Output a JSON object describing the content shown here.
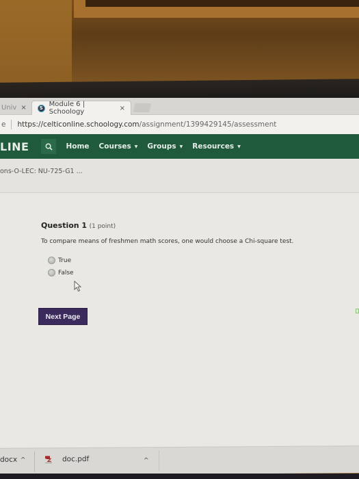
{
  "browser": {
    "tabs": [
      {
        "label": "Univ",
        "active": false,
        "close": "×"
      },
      {
        "label": "Module 6 | Schoology",
        "active": true,
        "favicon": "S",
        "close": "×"
      }
    ],
    "address": {
      "security_fragment": "e",
      "host": "https://celticonline.schoology.com",
      "path": "/assignment/1399429145/assessment"
    }
  },
  "navbar": {
    "logo": "LINE",
    "items": [
      {
        "label": "Home",
        "dropdown": false
      },
      {
        "label": "Courses",
        "dropdown": true
      },
      {
        "label": "Groups",
        "dropdown": true
      },
      {
        "label": "Resources",
        "dropdown": true
      }
    ],
    "caret": "▼"
  },
  "breadcrumb": "ons-O-LEC: NU-725-G1 ...",
  "question": {
    "title": "Question 1",
    "points": "(1 point)",
    "text": "To compare means of freshmen math scores, one would choose a Chi-square test.",
    "options": [
      {
        "label": "True",
        "selected": false
      },
      {
        "label": "False",
        "selected": false
      }
    ]
  },
  "next_button": "Next Page",
  "downloads": {
    "items": [
      {
        "name": "docx",
        "chevron": "^"
      },
      {
        "name": "doc.pdf",
        "chevron": "^"
      }
    ],
    "more_chevron": "^"
  }
}
